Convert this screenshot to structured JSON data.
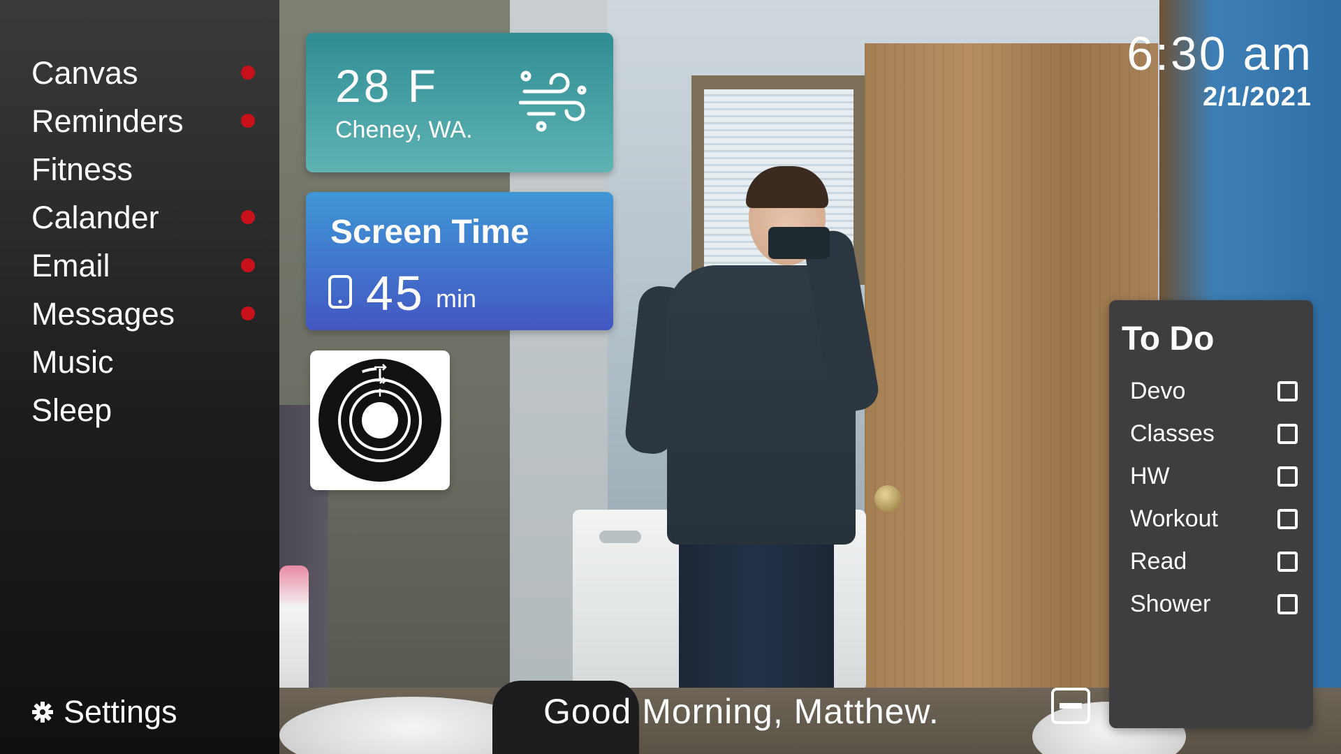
{
  "sidebar": {
    "items": [
      {
        "label": "Canvas",
        "notification": true
      },
      {
        "label": "Reminders",
        "notification": true
      },
      {
        "label": "Fitness",
        "notification": false
      },
      {
        "label": "Calander",
        "notification": true
      },
      {
        "label": "Email",
        "notification": true
      },
      {
        "label": "Messages",
        "notification": true
      },
      {
        "label": "Music",
        "notification": false
      },
      {
        "label": "Sleep",
        "notification": false
      }
    ],
    "settings_label": "Settings",
    "settings_icon": "gear-icon",
    "notification_color": "#c8111a"
  },
  "weather": {
    "temperature": "28 F",
    "location": "Cheney, WA.",
    "icon": "wind-icon"
  },
  "screen_time": {
    "title": "Screen Time",
    "value": "45",
    "unit": "min",
    "icon": "phone-icon"
  },
  "fitness": {
    "icon": "activity-rings-icon"
  },
  "clock": {
    "time": "6:30 am",
    "date": "2/1/2021"
  },
  "todo": {
    "title": "To Do",
    "items": [
      {
        "label": "Devo",
        "checked": false
      },
      {
        "label": "Classes",
        "checked": false
      },
      {
        "label": "HW",
        "checked": false
      },
      {
        "label": "Workout",
        "checked": false
      },
      {
        "label": "Read",
        "checked": false
      },
      {
        "label": "Shower",
        "checked": false
      }
    ]
  },
  "greeting": "Good Morning, Matthew.",
  "toggle_icon": "minimize-icon",
  "colors": {
    "weather_card": "#2f8d93",
    "screen_time_card": "#4357c3",
    "todo_panel": "#3e3e40"
  }
}
